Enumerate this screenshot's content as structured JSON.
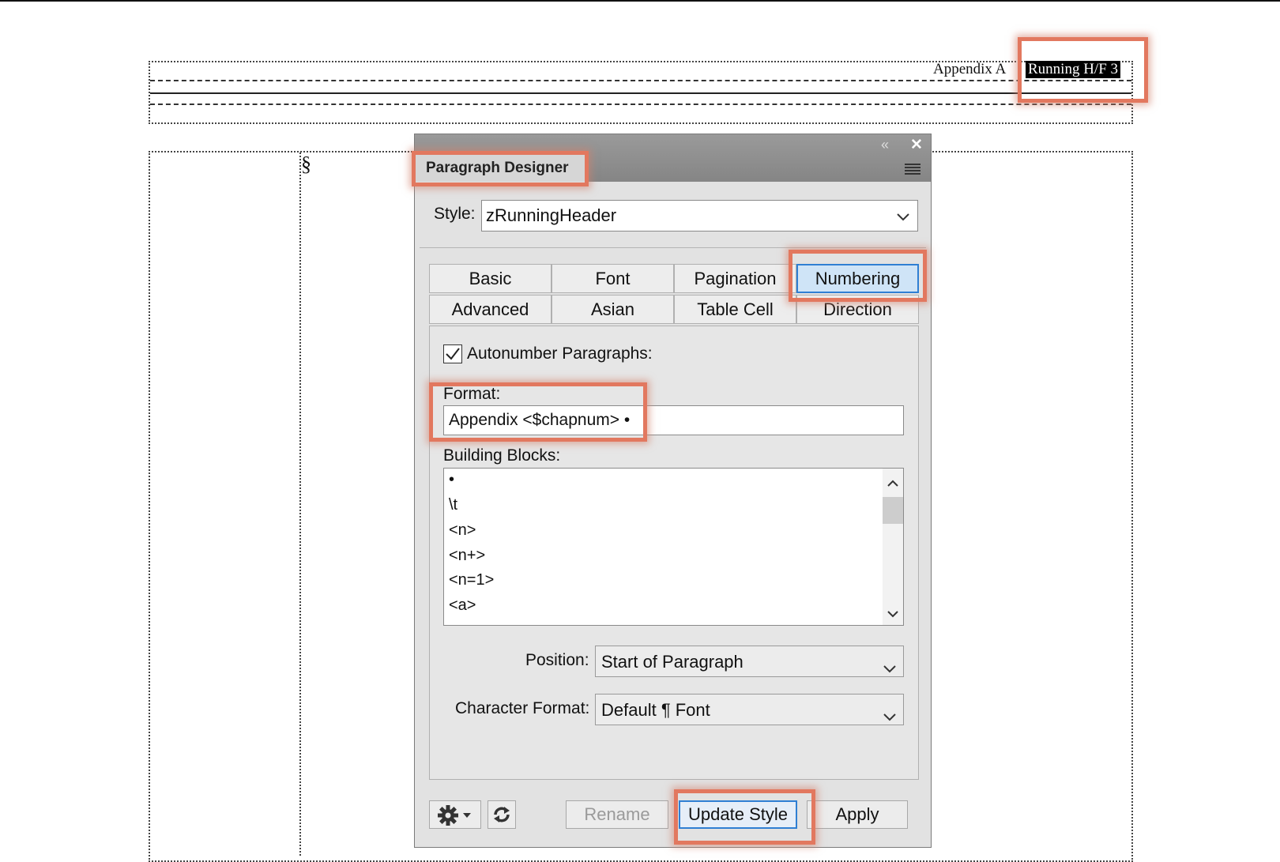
{
  "document": {
    "header_text_static": "Appendix A",
    "header_text_variable": "Running H/F 3",
    "section_mark": "§"
  },
  "panel": {
    "title": "Paragraph Designer",
    "collapse_glyph": "«",
    "close_glyph": "✕",
    "style_label": "Style:",
    "style_value": "zRunningHeader",
    "tabs": [
      {
        "label": "Basic",
        "active": false
      },
      {
        "label": "Font",
        "active": false
      },
      {
        "label": "Pagination",
        "active": false
      },
      {
        "label": "Numbering",
        "active": true
      },
      {
        "label": "Advanced",
        "active": false
      },
      {
        "label": "Asian",
        "active": false
      },
      {
        "label": "Table Cell",
        "active": false
      },
      {
        "label": "Direction",
        "active": false
      }
    ],
    "autonumber_label": "Autonumber Paragraphs:",
    "autonumber_checked": true,
    "format_label": "Format:",
    "format_value": "Appendix <$chapnum> •",
    "building_blocks_label": "Building Blocks:",
    "building_blocks": [
      "•",
      "\\t",
      "<n>",
      "<n+>",
      "<n=1>",
      "<a>"
    ],
    "position_label": "Position:",
    "position_value": "Start of Paragraph",
    "char_format_label": "Character Format:",
    "char_format_value": "Default ¶ Font",
    "buttons": {
      "rename": "Rename",
      "update_style": "Update Style",
      "apply": "Apply"
    }
  },
  "colors": {
    "highlight": "#e2785f",
    "active_tab": "#cfe4f7",
    "active_border": "#2f7fd3"
  }
}
